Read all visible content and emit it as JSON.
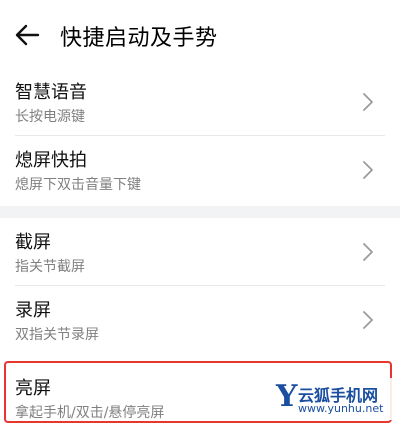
{
  "header": {
    "title": "快捷启动及手势",
    "back_icon": "back-arrow-icon"
  },
  "groups": [
    {
      "items": [
        {
          "title": "智慧语音",
          "subtitle": "长按电源键"
        },
        {
          "title": "熄屏快拍",
          "subtitle": "熄屏下双击音量下键"
        }
      ]
    },
    {
      "items": [
        {
          "title": "截屏",
          "subtitle": "指关节截屏"
        },
        {
          "title": "录屏",
          "subtitle": "双指关节录屏"
        },
        {
          "title": "亮屏",
          "subtitle": "拿起手机/双击/悬停亮屏"
        }
      ]
    }
  ],
  "watermark": {
    "logo": "Y",
    "name": "云狐手机网",
    "url": "www.yunhu.net"
  },
  "colors": {
    "highlight": "#e8362f",
    "band": "#f1f3f5",
    "subtitle": "#808080",
    "watermark": "#1a4fa0"
  }
}
